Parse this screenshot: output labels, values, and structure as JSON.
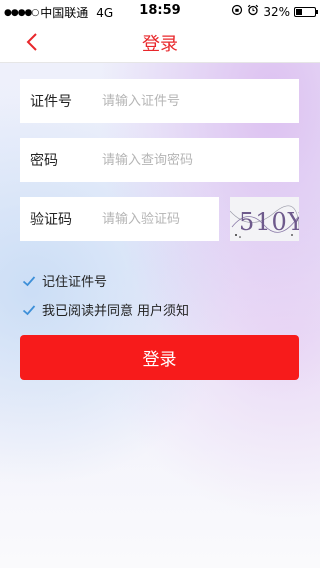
{
  "status_bar": {
    "signal": "●●●●○",
    "carrier": "中国联通",
    "network": "4G",
    "time": "18:59",
    "battery_percent": "32%",
    "battery_level": 0.32,
    "icons": [
      "orientation-lock-icon",
      "alarm-icon"
    ]
  },
  "nav": {
    "back_icon": "chevron-left-icon",
    "title": "登录"
  },
  "form": {
    "id_label": "证件号",
    "id_placeholder": "请输入证件号",
    "password_label": "密码",
    "password_placeholder": "请输入查询密码",
    "captcha_label": "验证码",
    "captcha_placeholder": "请输入验证码",
    "captcha_text": "510Y"
  },
  "options": {
    "remember_id": "记住证件号",
    "agree_prefix": "我已阅读并同意",
    "agree_link": "用户须知"
  },
  "login_button": "登录",
  "colors": {
    "accent": "#e8272b",
    "button": "#f71b1b",
    "check": "#3d8fd8"
  }
}
